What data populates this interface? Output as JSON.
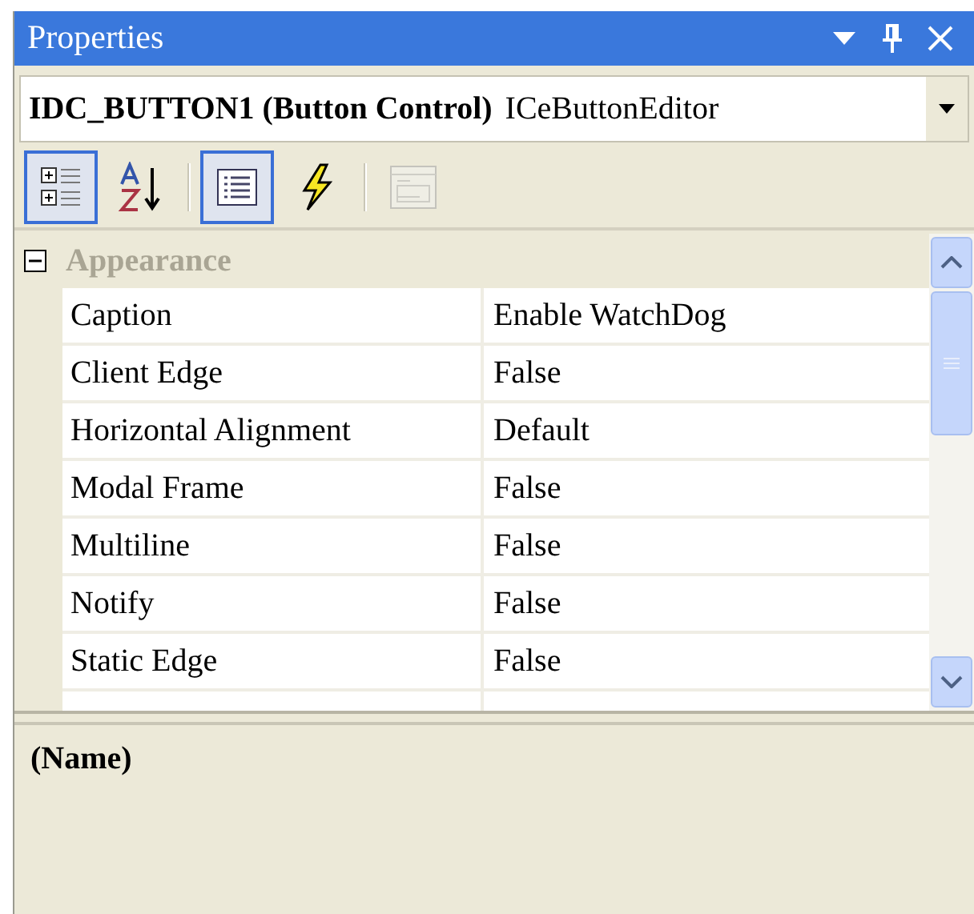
{
  "window": {
    "title": "Properties"
  },
  "object_selector": {
    "name": "IDC_BUTTON1 (Button Control)",
    "type": "ICeButtonEditor"
  },
  "toolbar": [
    {
      "kind": "categorized",
      "selected": true,
      "disabled": false
    },
    {
      "kind": "alphabetical",
      "selected": false,
      "disabled": false
    },
    {
      "kind": "separator"
    },
    {
      "kind": "properties",
      "selected": true,
      "disabled": false
    },
    {
      "kind": "events",
      "selected": false,
      "disabled": false
    },
    {
      "kind": "separator"
    },
    {
      "kind": "property_pages",
      "selected": false,
      "disabled": true
    }
  ],
  "grid": {
    "category": {
      "label": "Appearance",
      "expanded": true
    },
    "rows": [
      {
        "name": "Caption",
        "value": "Enable WatchDog"
      },
      {
        "name": "Client Edge",
        "value": "False"
      },
      {
        "name": "Horizontal Alignment",
        "value": "Default"
      },
      {
        "name": "Modal Frame",
        "value": "False"
      },
      {
        "name": "Multiline",
        "value": "False"
      },
      {
        "name": "Notify",
        "value": "False"
      },
      {
        "name": "Static Edge",
        "value": "False"
      }
    ]
  },
  "description": {
    "title": "(Name)"
  }
}
